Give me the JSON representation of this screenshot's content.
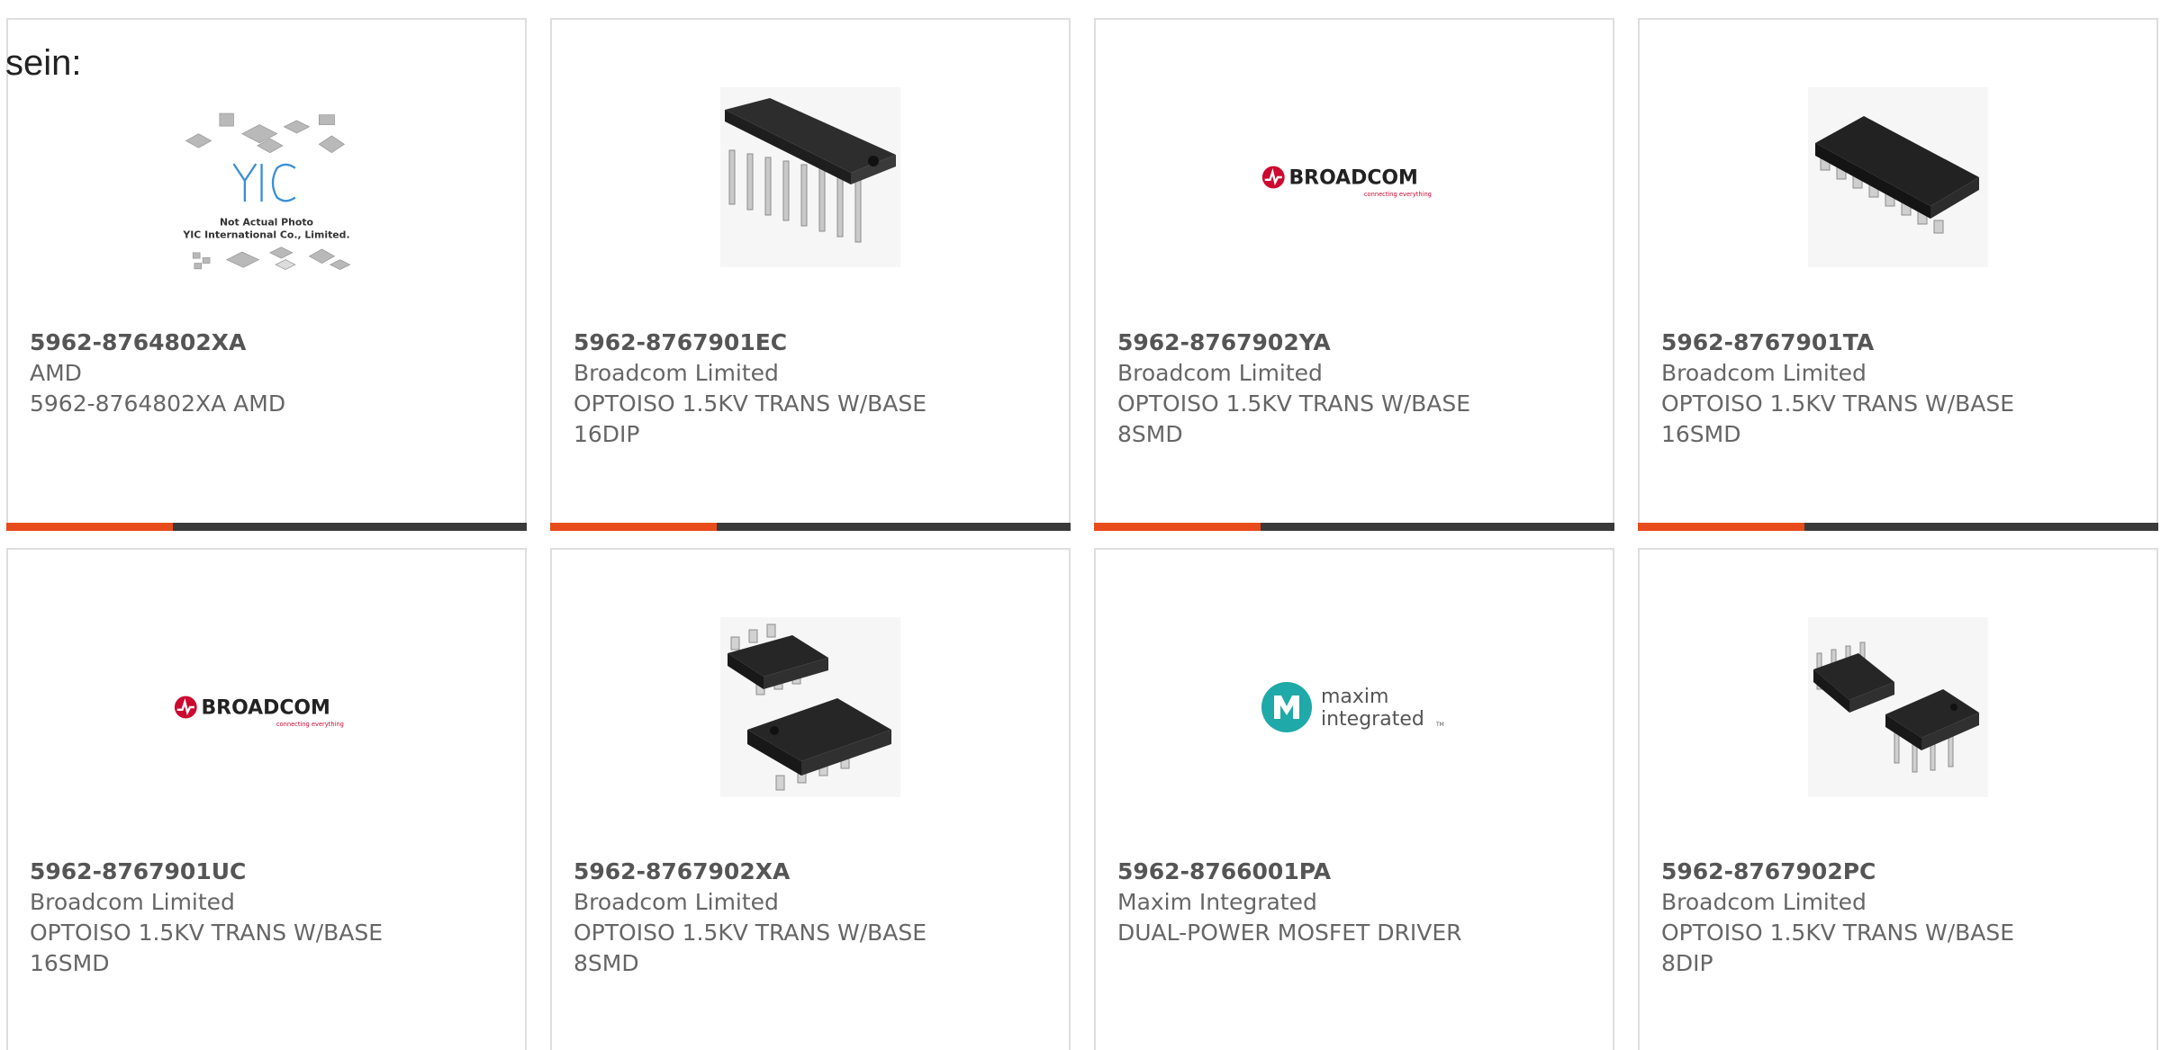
{
  "page": {
    "cut_label": "sein:",
    "accent_color": "#e84b1a",
    "bar_color": "#3a3a3a"
  },
  "products": [
    {
      "part": "5962-8764802XA",
      "maker": "AMD",
      "desc": "5962-8764802XA AMD",
      "image": "yic-placeholder",
      "image_text_1": "Not Actual Photo",
      "image_text_2": "YIC International Co., Limited.",
      "image_logo": "YIC"
    },
    {
      "part": "5962-8767901EC",
      "maker": "Broadcom Limited",
      "desc": "OPTOISO 1.5KV TRANS W/BASE\n16DIP",
      "image": "dip16-chip"
    },
    {
      "part": "5962-8767902YA",
      "maker": "Broadcom Limited",
      "desc": "OPTOISO 1.5KV TRANS W/BASE\n8SMD",
      "image": "broadcom-logo",
      "logo_text": "BROADCOM",
      "logo_tagline": "connecting everything"
    },
    {
      "part": "5962-8767901TA",
      "maker": "Broadcom Limited",
      "desc": "OPTOISO 1.5KV TRANS W/BASE\n16SMD",
      "image": "smd16-chip"
    },
    {
      "part": "5962-8767901UC",
      "maker": "Broadcom Limited",
      "desc": "OPTOISO 1.5KV TRANS W/BASE\n16SMD",
      "image": "broadcom-logo",
      "logo_text": "BROADCOM",
      "logo_tagline": "connecting everything"
    },
    {
      "part": "5962-8767902XA",
      "maker": "Broadcom Limited",
      "desc": "OPTOISO 1.5KV TRANS W/BASE\n8SMD",
      "image": "smd8-chips"
    },
    {
      "part": "5962-8766001PA",
      "maker": "Maxim Integrated",
      "desc": "DUAL-POWER MOSFET DRIVER",
      "image": "maxim-logo",
      "logo_text_1": "maxim",
      "logo_text_2": "integrated"
    },
    {
      "part": "5962-8767902PC",
      "maker": "Broadcom Limited",
      "desc": "OPTOISO 1.5KV TRANS W/BASE\n8DIP",
      "image": "dip8-chips"
    }
  ]
}
